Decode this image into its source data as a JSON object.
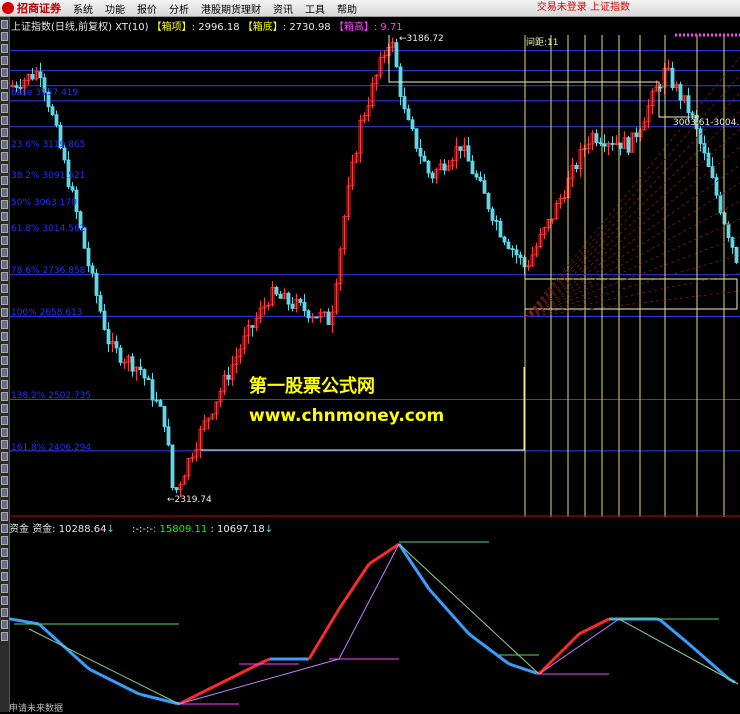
{
  "app": {
    "logo_text": "招商证券",
    "menu": [
      "系统",
      "功能",
      "报价",
      "分析",
      "港股期货理财",
      "资讯",
      "工具",
      "帮助"
    ],
    "status_right": "交易未登录  上证指数"
  },
  "main_chart": {
    "title": "上证指数(日线,前复权)",
    "indicator": "XT(10)",
    "top_label": "【箱项】",
    "top_value": ": 2996.18",
    "bottom_label": "【箱底】",
    "bottom_value": ": 2730.98",
    "height_label": "【箱高】",
    "height_value": ": 9.71",
    "fibo_levels": [
      {
        "label": "base 3157.419",
        "value": 3157.419
      },
      {
        "label": "23.6% 3119.865",
        "value": 3119.865
      },
      {
        "label": "38.2% 3091.521",
        "value": 3091.521
      },
      {
        "label": "50% 3063.170",
        "value": 3063.17
      },
      {
        "label": "61.8% 3014.562",
        "value": 3014.562
      },
      {
        "label": "78.6% 2736.858",
        "value": 2736.858
      },
      {
        "label": "100% 2658.613",
        "value": 2658.613
      },
      {
        "label": "138.2% 2502.735",
        "value": 2502.735
      },
      {
        "label": "161.8% 2406.294",
        "value": 2406.294
      }
    ],
    "high_marker": "3186.72",
    "low_marker": "2319.74",
    "range_marker": "3003.61-3004.",
    "interval_label": "间距:11",
    "colors": {
      "up": "#ff3c3c",
      "down": "#5fd7e8",
      "fibo": "#2d3cff",
      "box": "#f0f0b4",
      "time_line": "#e8d870",
      "separator": "#c80000"
    }
  },
  "watermark": {
    "title": "第一股票公式网",
    "url": "www.chnmoney.com"
  },
  "sub_chart": {
    "name": "资金",
    "label": "资金:",
    "value": "10288.64",
    "arrow": "↓",
    "dashes": ":-:-:-",
    "value2": ": 15809.11",
    "value3": ": 10697.18",
    "arrow2": "↓"
  },
  "footer": "申请未来数据"
}
